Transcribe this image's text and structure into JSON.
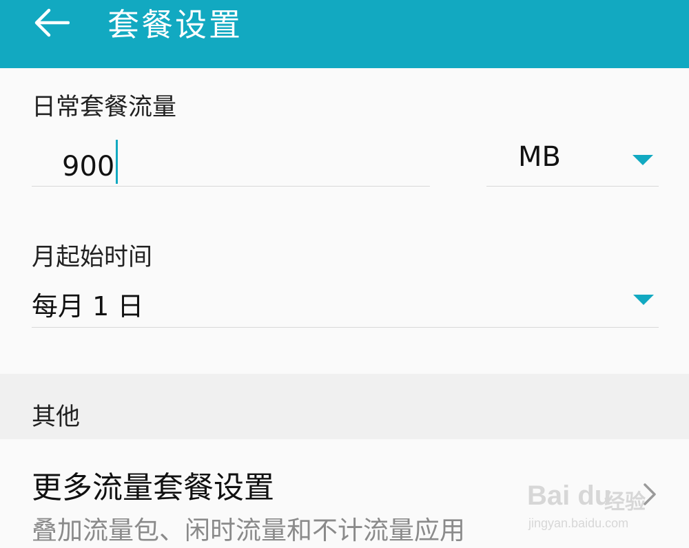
{
  "header": {
    "title": "套餐设置",
    "back_icon": "arrow-left-icon",
    "background": "#12a9c1"
  },
  "daily_plan": {
    "label": "日常套餐流量",
    "value": "900",
    "unit": "MB",
    "dropdown_icon": "triangle-down-icon"
  },
  "start_date": {
    "label": "月起始时间",
    "value": "每月 1 日",
    "dropdown_icon": "triangle-down-icon"
  },
  "other_group": {
    "label": "其他"
  },
  "more_settings": {
    "title": "更多流量套餐设置",
    "subtitle": "叠加流量包、闲时流量和不计流量应用",
    "chevron_icon": "chevron-right-icon"
  },
  "watermark": {
    "brand": "Bai du",
    "brand_cn": "经验",
    "url": "jingyan.baidu.com"
  },
  "colors": {
    "accent": "#12a9c1",
    "divider": "#d8d8d8",
    "group_bg": "#f0f0f0",
    "secondary_text": "#8a8a8a"
  }
}
